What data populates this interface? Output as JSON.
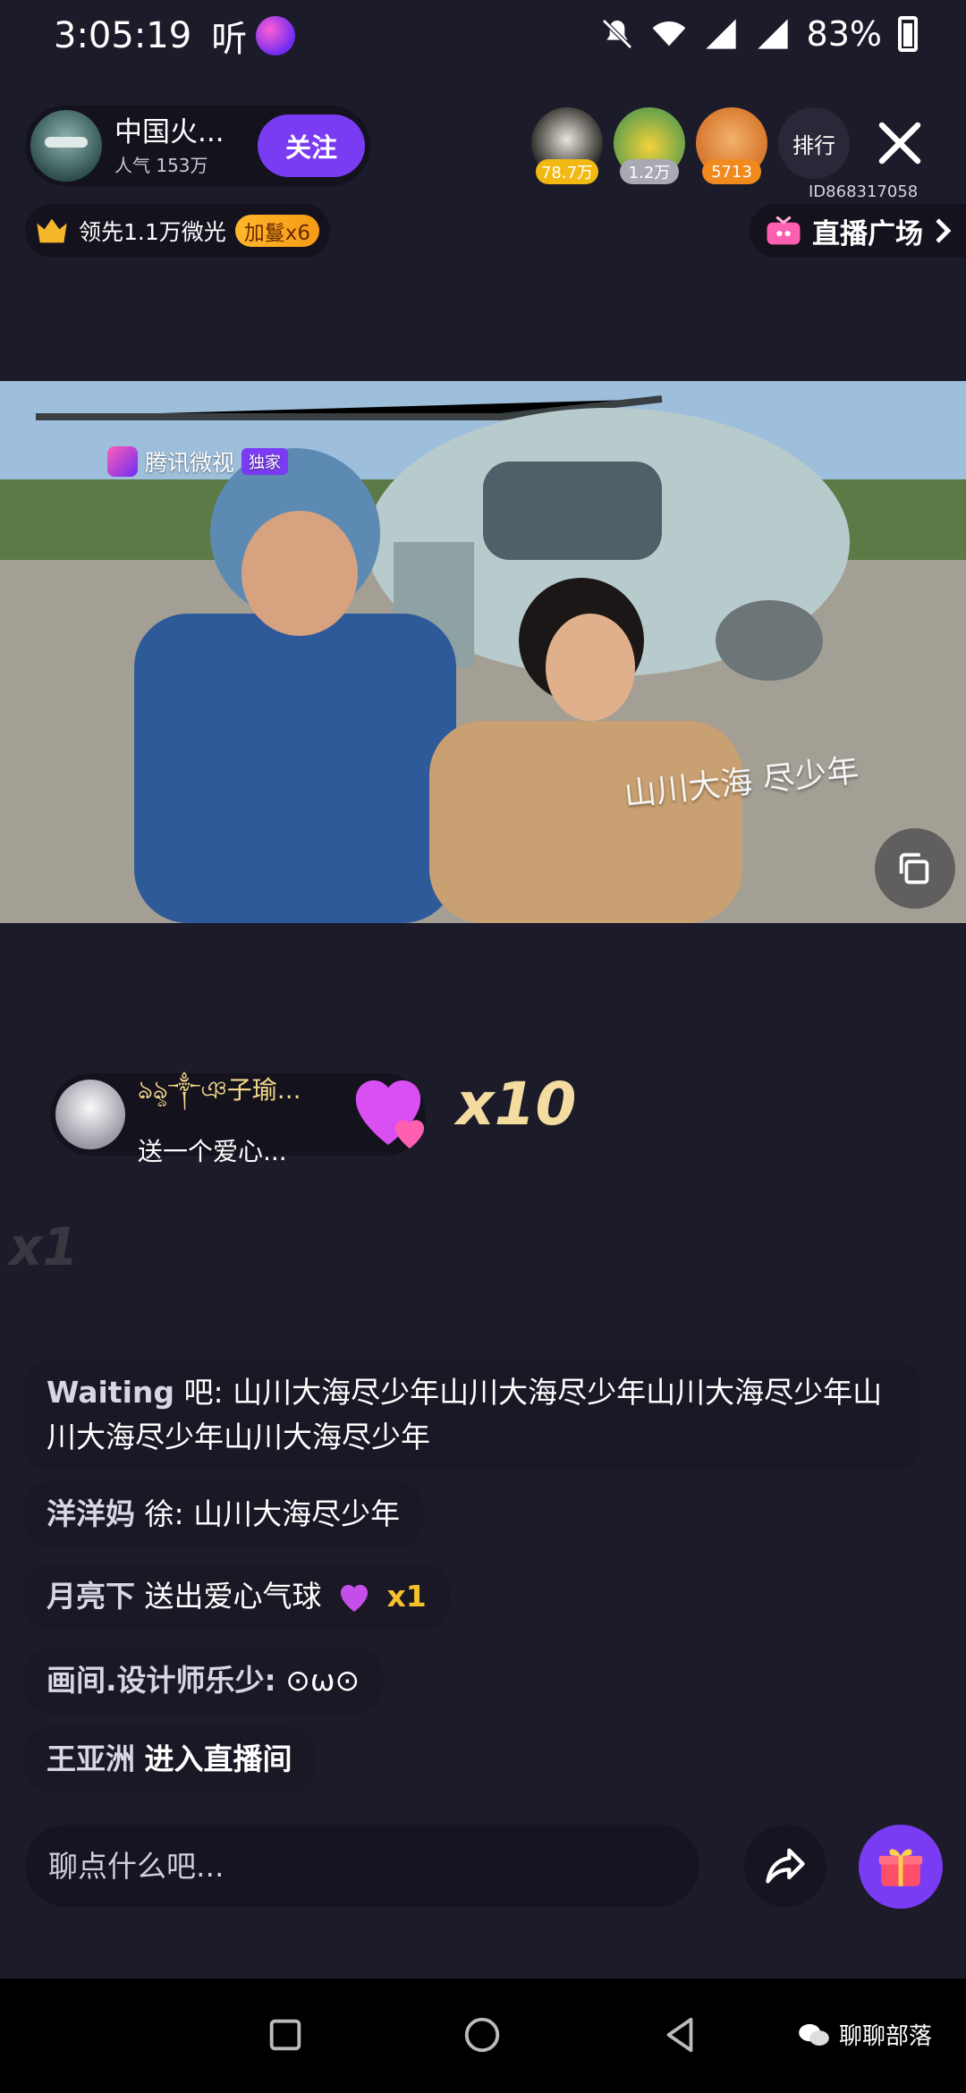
{
  "status_bar": {
    "time": "3:05:19",
    "ting": "听",
    "battery": "83%"
  },
  "anchor": {
    "name": "中国火...",
    "popularity": "人气 153万",
    "follow_label": "关注"
  },
  "viewers": [
    {
      "badge": "78.7万"
    },
    {
      "badge": "1.2万"
    },
    {
      "badge": "5713"
    }
  ],
  "rank_label": "排行",
  "room_id": "ID868317058",
  "lead": {
    "text": "领先1.1万微光",
    "badge": "加鬘x6"
  },
  "plaza": {
    "label": "直播广场"
  },
  "video": {
    "watermark": "腾讯微视",
    "watermark_tag": "独家",
    "caption": "山川大海 尽少年"
  },
  "gift": {
    "user": "ঌৡ༒ঞ子瑜...",
    "desc": "送一个爱心...",
    "count": "x10"
  },
  "ghost_count": "x1",
  "chat": [
    {
      "name": "Waiting",
      "text": "吧: 山川大海尽少年山川大海尽少年山川大海尽少年山川大海尽少年山川大海尽少年"
    },
    {
      "name": "洋洋妈",
      "text": "徐: 山川大海尽少年"
    },
    {
      "name": "月亮下",
      "text": "送出爱心气球",
      "count": "x1"
    },
    {
      "name": "画间.设计师乐少:",
      "text": "⊙ω⊙"
    },
    {
      "name": "王亚洲",
      "text": "进入直播间"
    }
  ],
  "input": {
    "placeholder": "聊点什么吧..."
  },
  "footer": {
    "brand": "聊聊部落"
  },
  "colors": {
    "accent": "#7a3cf2",
    "background": "#1c1b2a",
    "gold": "#f5c22c"
  }
}
